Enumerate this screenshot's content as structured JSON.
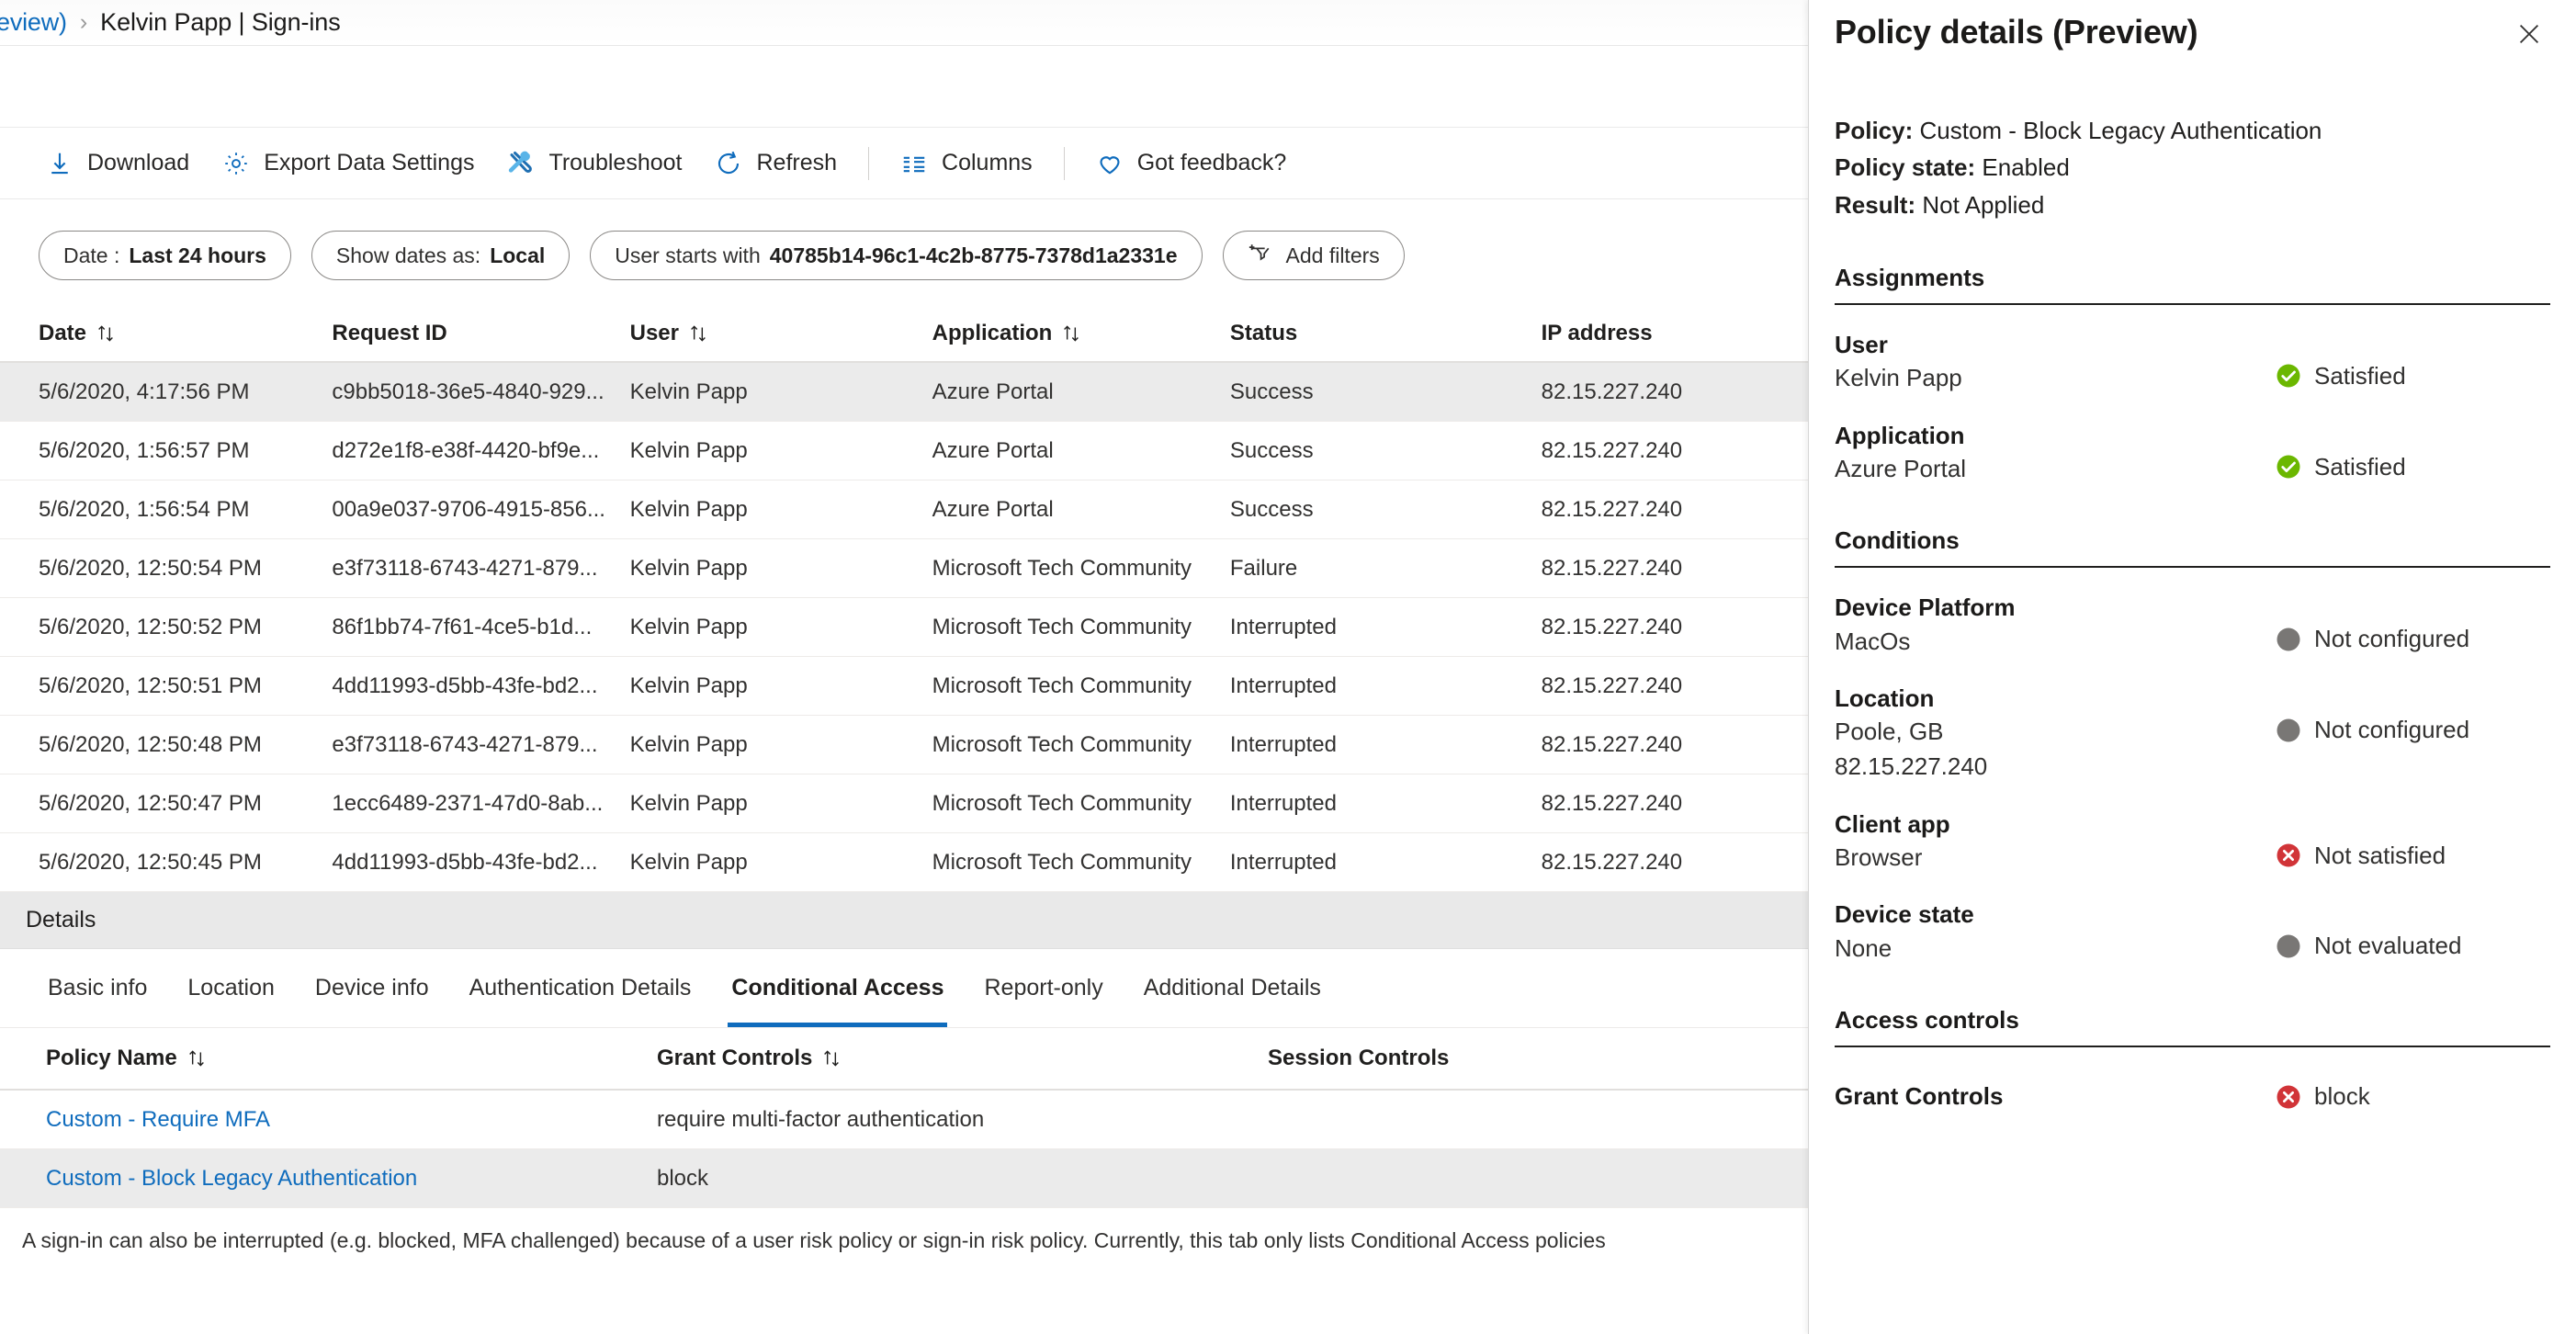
{
  "breadcrumb": {
    "previous_truncated": "eview)",
    "separator": "›",
    "current": "Kelvin Papp | Sign-ins"
  },
  "commandbar": {
    "items": [
      {
        "label": "Download",
        "icon": "download-icon"
      },
      {
        "label": "Export Data Settings",
        "icon": "gear-icon"
      },
      {
        "label": "Troubleshoot",
        "icon": "wrench-screwdriver-icon"
      },
      {
        "label": "Refresh",
        "icon": "refresh-icon"
      },
      {
        "label": "Columns",
        "icon": "columns-icon"
      },
      {
        "label": "Got feedback?",
        "icon": "heart-icon"
      }
    ]
  },
  "filters": [
    {
      "label": "Date :",
      "value": "Last 24 hours"
    },
    {
      "label": "Show dates as:",
      "value": "Local"
    },
    {
      "label": "User starts with",
      "value": "40785b14-96c1-4c2b-8775-7378d1a2331e"
    },
    {
      "label": "Add filters",
      "value": "",
      "icon": "add-filter-icon"
    }
  ],
  "signins_table": {
    "columns": [
      {
        "label": "Date",
        "sortable": true
      },
      {
        "label": "Request ID",
        "sortable": false
      },
      {
        "label": "User",
        "sortable": true
      },
      {
        "label": "Application",
        "sortable": true
      },
      {
        "label": "Status",
        "sortable": false
      },
      {
        "label": "IP address",
        "sortable": false
      }
    ],
    "rows": [
      {
        "date": "5/6/2020, 4:17:56 PM",
        "request_id": "c9bb5018-36e5-4840-929...",
        "user": "Kelvin Papp",
        "application": "Azure Portal",
        "status": "Success",
        "ip": "82.15.227.240",
        "selected": true
      },
      {
        "date": "5/6/2020, 1:56:57 PM",
        "request_id": "d272e1f8-e38f-4420-bf9e...",
        "user": "Kelvin Papp",
        "application": "Azure Portal",
        "status": "Success",
        "ip": "82.15.227.240",
        "selected": false
      },
      {
        "date": "5/6/2020, 1:56:54 PM",
        "request_id": "00a9e037-9706-4915-856...",
        "user": "Kelvin Papp",
        "application": "Azure Portal",
        "status": "Success",
        "ip": "82.15.227.240",
        "selected": false
      },
      {
        "date": "5/6/2020, 12:50:54 PM",
        "request_id": "e3f73118-6743-4271-879...",
        "user": "Kelvin Papp",
        "application": "Microsoft Tech Community",
        "status": "Failure",
        "ip": "82.15.227.240",
        "selected": false
      },
      {
        "date": "5/6/2020, 12:50:52 PM",
        "request_id": "86f1bb74-7f61-4ce5-b1d...",
        "user": "Kelvin Papp",
        "application": "Microsoft Tech Community",
        "status": "Interrupted",
        "ip": "82.15.227.240",
        "selected": false
      },
      {
        "date": "5/6/2020, 12:50:51 PM",
        "request_id": "4dd11993-d5bb-43fe-bd2...",
        "user": "Kelvin Papp",
        "application": "Microsoft Tech Community",
        "status": "Interrupted",
        "ip": "82.15.227.240",
        "selected": false
      },
      {
        "date": "5/6/2020, 12:50:48 PM",
        "request_id": "e3f73118-6743-4271-879...",
        "user": "Kelvin Papp",
        "application": "Microsoft Tech Community",
        "status": "Interrupted",
        "ip": "82.15.227.240",
        "selected": false
      },
      {
        "date": "5/6/2020, 12:50:47 PM",
        "request_id": "1ecc6489-2371-47d0-8ab...",
        "user": "Kelvin Papp",
        "application": "Microsoft Tech Community",
        "status": "Interrupted",
        "ip": "82.15.227.240",
        "selected": false
      },
      {
        "date": "5/6/2020, 12:50:45 PM",
        "request_id": "4dd11993-d5bb-43fe-bd2...",
        "user": "Kelvin Papp",
        "application": "Microsoft Tech Community",
        "status": "Interrupted",
        "ip": "82.15.227.240",
        "selected": false
      }
    ]
  },
  "details": {
    "header": "Details",
    "tabs": [
      {
        "label": "Basic info",
        "active": false
      },
      {
        "label": "Location",
        "active": false
      },
      {
        "label": "Device info",
        "active": false
      },
      {
        "label": "Authentication Details",
        "active": false
      },
      {
        "label": "Conditional Access",
        "active": true
      },
      {
        "label": "Report-only",
        "active": false
      },
      {
        "label": "Additional Details",
        "active": false
      }
    ],
    "policy_table": {
      "columns": [
        {
          "label": "Policy Name",
          "sortable": true
        },
        {
          "label": "Grant Controls",
          "sortable": true
        },
        {
          "label": "Session Controls",
          "sortable": false
        }
      ],
      "rows": [
        {
          "policy_name": "Custom - Require MFA",
          "grant_controls": "require multi-factor authentication",
          "session_controls": ""
        },
        {
          "policy_name": "Custom - Block Legacy Authentication",
          "grant_controls": "block",
          "session_controls": ""
        }
      ]
    },
    "footnote": "A sign-in can also be interrupted (e.g. blocked, MFA challenged) because of a user risk policy or sign-in risk policy. Currently, this tab only lists Conditional Access policies"
  },
  "panel": {
    "title": "Policy details (Preview)",
    "close_icon": "close-icon",
    "summary": {
      "policy_label": "Policy:",
      "policy_value": "Custom - Block Legacy Authentication",
      "state_label": "Policy state:",
      "state_value": "Enabled",
      "result_label": "Result:",
      "result_value": "Not Applied"
    },
    "assignments": {
      "title": "Assignments",
      "items": [
        {
          "label": "User",
          "value": "Kelvin Papp",
          "status": "Satisfied",
          "status_kind": "satisfied"
        },
        {
          "label": "Application",
          "value": "Azure Portal",
          "status": "Satisfied",
          "status_kind": "satisfied"
        }
      ]
    },
    "conditions": {
      "title": "Conditions",
      "items": [
        {
          "label": "Device Platform",
          "value": "MacOs",
          "status": "Not configured",
          "status_kind": "neutral"
        },
        {
          "label": "Location",
          "value": "Poole, GB\n82.15.227.240",
          "status": "Not configured",
          "status_kind": "neutral"
        },
        {
          "label": "Client app",
          "value": "Browser",
          "status": "Not satisfied",
          "status_kind": "error"
        },
        {
          "label": "Device state",
          "value": "None",
          "status": "Not evaluated",
          "status_kind": "neutral"
        }
      ]
    },
    "access_controls": {
      "title": "Access controls",
      "items": [
        {
          "label": "Grant Controls",
          "status": "block",
          "status_kind": "error"
        }
      ]
    }
  },
  "colors": {
    "accent_blue": "#0f6cbd",
    "link_blue": "#0f6cbd",
    "success_green": "#6bb700",
    "error_red": "#d13438",
    "neutral_gray": "#797775",
    "selected_row": "#ebebeb"
  }
}
